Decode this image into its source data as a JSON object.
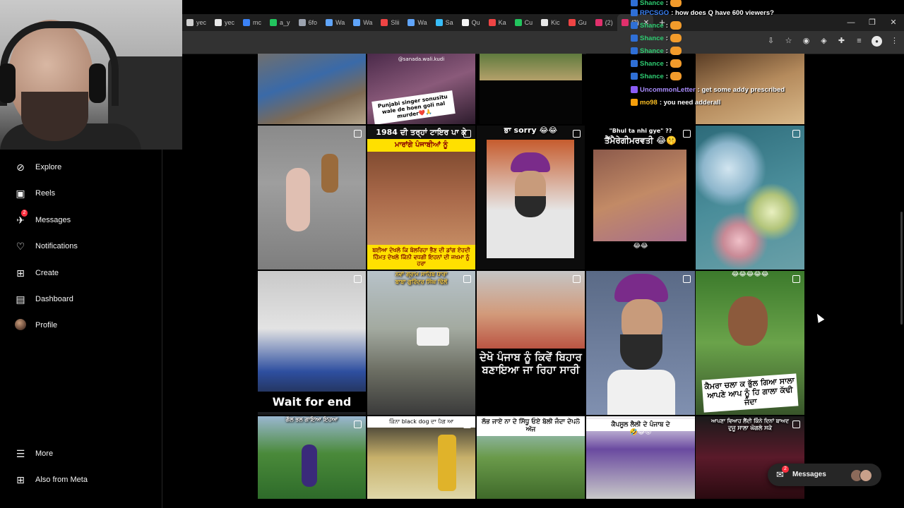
{
  "browser": {
    "tabs": [
      {
        "label": "yec",
        "color": "#cfcfcf"
      },
      {
        "label": "yec",
        "color": "#e8e8e8"
      },
      {
        "label": "mc",
        "color": "#3b82f6"
      },
      {
        "label": "a_y",
        "color": "#22c55e"
      },
      {
        "label": "6fo",
        "color": "#9ca3af"
      },
      {
        "label": "Wa",
        "color": "#60a5fa"
      },
      {
        "label": "Wa",
        "color": "#60a5fa"
      },
      {
        "label": "Slii",
        "color": "#ef4444"
      },
      {
        "label": "Wa",
        "color": "#60a5fa"
      },
      {
        "label": "Sa",
        "color": "#38bdf8"
      },
      {
        "label": "Qu",
        "color": "#f5f5f5"
      },
      {
        "label": "Ka",
        "color": "#ef4444"
      },
      {
        "label": "Cu",
        "color": "#22c55e"
      },
      {
        "label": "Kic",
        "color": "#e8e8e8"
      },
      {
        "label": "Gu",
        "color": "#ef4444"
      },
      {
        "label": "(2)",
        "color": "#e1306c"
      },
      {
        "label": "(2)",
        "color": "#e1306c"
      }
    ],
    "new_tab": "+",
    "window_controls": [
      "—",
      "❐",
      "✕"
    ]
  },
  "sidebar": {
    "items": [
      {
        "label": "Explore",
        "icon": "compass-icon"
      },
      {
        "label": "Reels",
        "icon": "reels-icon"
      },
      {
        "label": "Messages",
        "icon": "messenger-icon",
        "badge": "2"
      },
      {
        "label": "Notifications",
        "icon": "heart-icon"
      },
      {
        "label": "Create",
        "icon": "plus-square-icon"
      },
      {
        "label": "Dashboard",
        "icon": "dashboard-icon"
      },
      {
        "label": "Profile",
        "icon": "avatar-icon"
      }
    ],
    "more": "More",
    "also_meta": "Also from Meta"
  },
  "grid": {
    "row0": [
      {
        "caption": "",
        "top_text": ""
      },
      {
        "caption": "Punjabi singer sonusitu wale de hoen goli nal murder❤️🙏",
        "top_text": "@sanada.wali.kudi"
      },
      {
        "caption": "",
        "top_text": ""
      },
      {
        "caption": "",
        "top_text": ""
      },
      {
        "caption": "",
        "top_text": ""
      }
    ],
    "row1": [
      {
        "caption": ""
      },
      {
        "caption_top": "1984 ਦੀ ਤਰ੍ਹਾਂ ਟਾਇਰ ਪਾ ਕੇ",
        "caption_top2": "ਮਾਰਾਂਗੇ ਪੰਜਾਬੀਆਂ ਨੂੰ",
        "caption_bottom": "ਬਈਆ ਦੇਖਲੋ ਕਿ ਬੋਲਰਿਹਾ ਭੈਣ ਦੀ ਡਾਂਗ ਏਹਦੀ ਹਿੰਮਤ ਦੇਖਲੋ ਕਿੰਨੀ ਵਧਗੀ ਇਹਨਾਂ ਦੀ ਜਖਮਾ ਨੂੰ ਹਰਾ"
      },
      {
        "caption_top": "ਭਾ sorry 😂😂"
      },
      {
        "caption_top": "\"Bhul ta nhi gye\" ??",
        "caption_top2": "ਤੈਂਮੈਰੇਗੀਮਰਵਤੀ 😂🤫",
        "caption_bottom": "😂😂"
      },
      {
        "caption": ""
      }
    ],
    "row2": [
      {
        "caption_bottom": "Wait for end"
      },
      {
        "caption_top": "ਨਵਾਂ ਗ੍ਰਾਮ ਸਾਹਿਬ ਧਾਰਾ",
        "caption_top2": "ਬਾਬਾ ਗੁਰਿੰਦਰ ਸਿੰਘ ਢਿੱਲੋਂ"
      },
      {
        "caption_bottom": "ਦੇਖੋ ਪੰਜਾਬ ਨੂੰ ਕਿਵੇਂ ਬਿਹਾਰ ਬਣਾਇਆ ਜਾ ਰਿਹਾ ਸਾਰੀ"
      },
      {
        "caption": ""
      },
      {
        "caption_top": "😂😂😂😂😂",
        "caption_bottom": "ਕੈਮਰਾ ਚਲਾ ਕ ਭੁੱਲ ਗਿਆ ਸਾਲਾ ਆਪਣੇ ਆਪ ਨੂੰ ਹਿ ਗਾਲਾ ਕੱਢੀ ਜੰਦਾ"
      }
    ],
    "row3": [
      {
        "caption_top": "ਗੱਲ ਭਲ ਗਾਇਆ ਇਹਆ"
      },
      {
        "caption_top": "ਕਿੰਨਾ black dog ਦਾ ਪੈਗ ਆ"
      },
      {
        "caption_top": "ਲੱਭ ਜਾਏ ਨਾ ਦੇ ਸਿੱਧੂ ਓਏ ਬੋਲੀ ਜੰਦਾ ਦੇਖਲੋ ਅੱਜ"
      },
      {
        "caption_top": "ਕੈਪਸੂਲ ਲੈਲੀ ਦੇ ਪੰਜਾਬ ਦੇ",
        "caption_top2": "🤣😂😝"
      },
      {
        "caption_top": "ਆਪਣਾ ਵਿਆਹ ਲੈਂਦੀ ਕਿੰਨੇ ਦਿਨਾਂ ਬਾਅਦ",
        "caption_top2": "ਦੁਜੂ ਸਾਲਾ ਘੋਗਲੇ ਸਕੇ"
      }
    ]
  },
  "chat": [
    {
      "user": "Shance",
      "msg": ":",
      "color": "#2ecc71",
      "emote": true
    },
    {
      "user": "RPCSGO",
      "msg": ": how does Q have 600 viewers?",
      "color": "#3b82f6",
      "emote": false
    },
    {
      "user": "Shance",
      "msg": ":",
      "color": "#2ecc71",
      "emote": true
    },
    {
      "user": "Shance",
      "msg": ":",
      "color": "#2ecc71",
      "emote": true
    },
    {
      "user": "Shance",
      "msg": ":",
      "color": "#2ecc71",
      "emote": true
    },
    {
      "user": "Shance",
      "msg": ":",
      "color": "#2ecc71",
      "emote": true
    },
    {
      "user": "Shance",
      "msg": ":",
      "color": "#2ecc71",
      "emote": true
    },
    {
      "user": "UncommonLetter",
      "msg": ": get some addy prescribed",
      "color": "#a78bfa",
      "emote": false
    },
    {
      "user": "mo98",
      "msg": ": you need adderall",
      "color": "#fbbf24",
      "emote": false
    }
  ],
  "messages_pill": {
    "label": "Messages",
    "badge": "2"
  },
  "colors": {
    "accent": "#ff3040",
    "background": "#000000"
  }
}
